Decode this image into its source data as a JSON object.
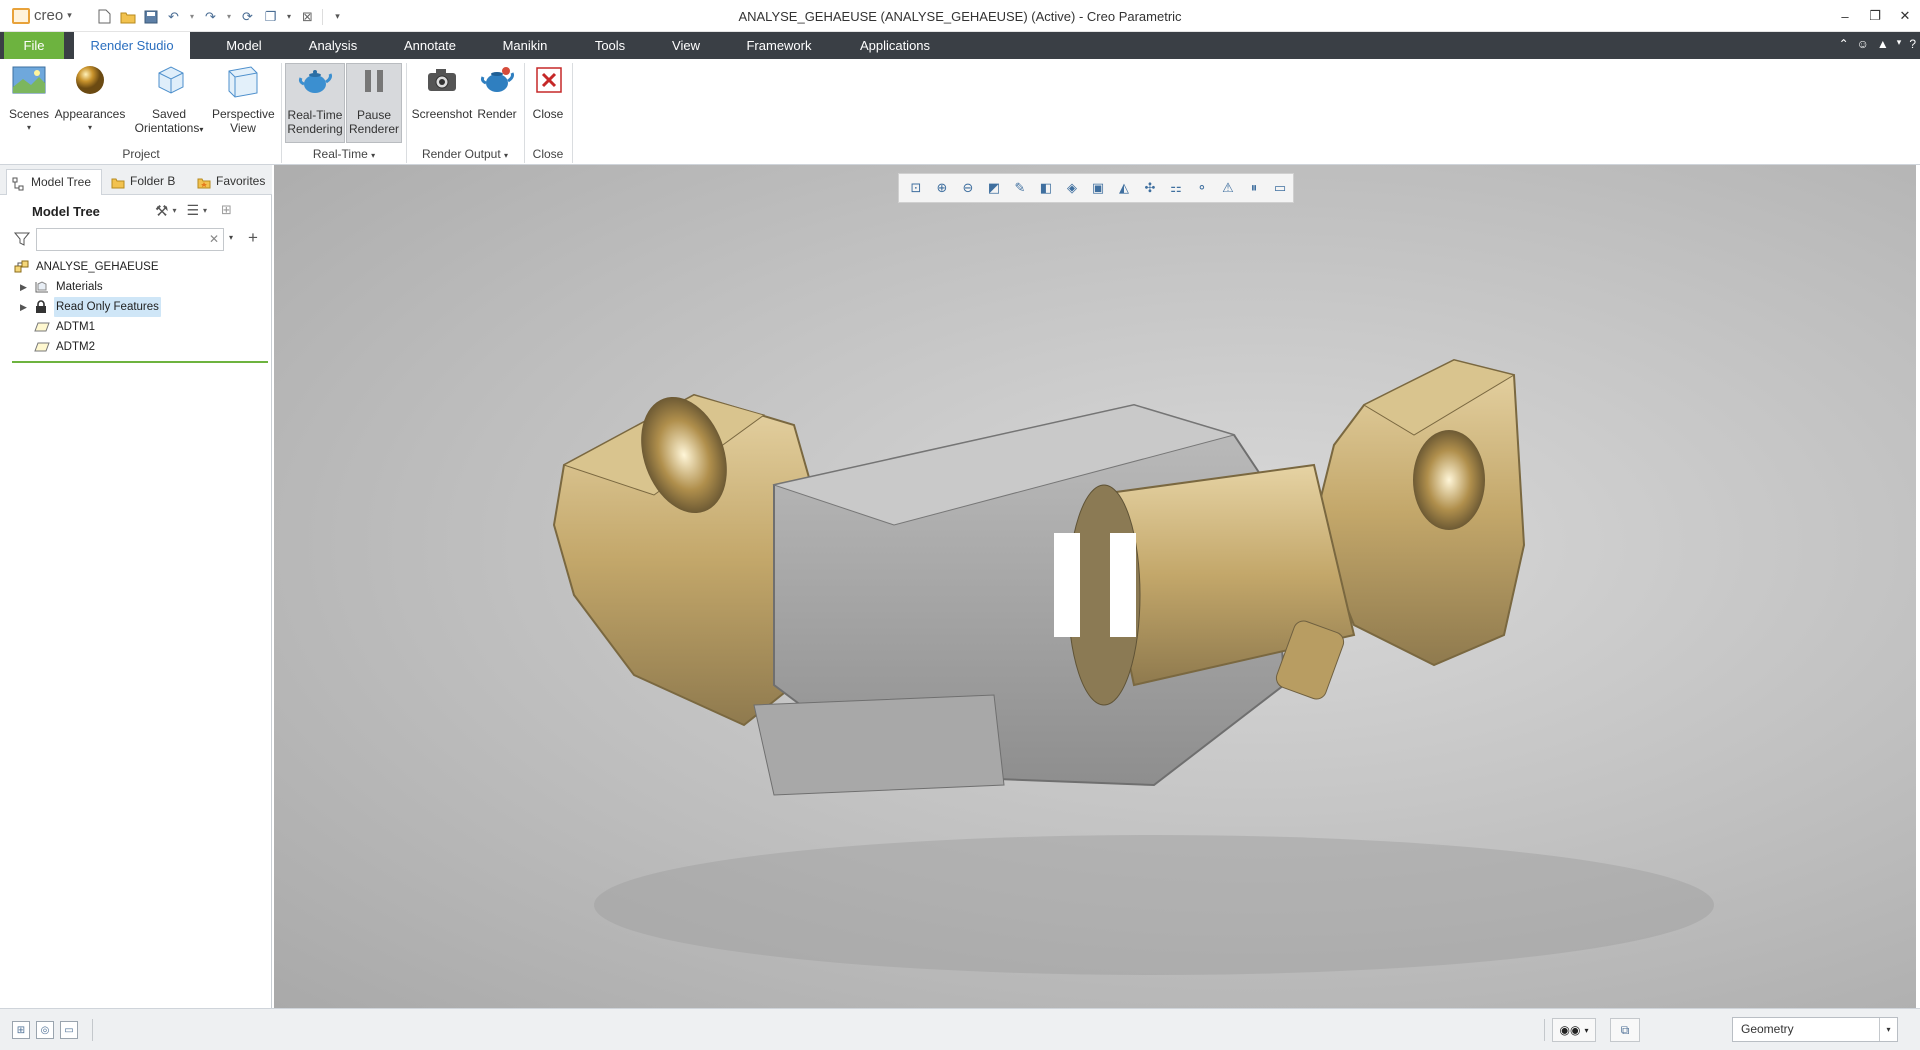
{
  "app": {
    "logo": "creo",
    "window_title": "ANALYSE_GEHAEUSE (ANALYSE_GEHAEUSE) (Active) - Creo Parametric"
  },
  "quick_access": [
    "new-icon",
    "open-icon",
    "save-icon",
    "undo-icon",
    "redo-icon",
    "regenerate-icon",
    "windows-icon",
    "close-window-icon",
    "customize-icon"
  ],
  "ribbon_tabs": [
    {
      "label": "File"
    },
    {
      "label": "Render Studio"
    },
    {
      "label": "Model"
    },
    {
      "label": "Analysis"
    },
    {
      "label": "Annotate"
    },
    {
      "label": "Manikin"
    },
    {
      "label": "Tools"
    },
    {
      "label": "View"
    },
    {
      "label": "Framework"
    },
    {
      "label": "Applications"
    }
  ],
  "ribbon": {
    "scenes": {
      "label": "Scenes"
    },
    "appearances": {
      "label": "Appearances"
    },
    "saved_orientations": {
      "label1": "Saved",
      "label2": "Orientations"
    },
    "perspective_view": {
      "label1": "Perspective",
      "label2": "View"
    },
    "realtime_rendering": {
      "label1": "Real-Time",
      "label2": "Rendering"
    },
    "pause_renderer": {
      "label1": "Pause",
      "label2": "Renderer"
    },
    "screenshot": {
      "label": "Screenshot"
    },
    "render": {
      "label": "Render"
    },
    "close": {
      "label": "Close"
    },
    "groups": {
      "project": "Project",
      "realtime": "Real-Time",
      "render_output": "Render Output",
      "close": "Close"
    }
  },
  "left_panel": {
    "tabs": [
      {
        "label": "Model Tree"
      },
      {
        "label": "Folder B"
      },
      {
        "label": "Favorites"
      }
    ],
    "title": "Model Tree",
    "search_placeholder": "",
    "tree": [
      {
        "label": "ANALYSE_GEHAEUSE",
        "icon": "assembly-icon"
      },
      {
        "label": "Materials",
        "icon": "materials-icon"
      },
      {
        "label": "Read Only Features",
        "icon": "lock-icon"
      },
      {
        "label": "ADTM1",
        "icon": "datum-plane-icon"
      },
      {
        "label": "ADTM2",
        "icon": "datum-plane-icon"
      }
    ]
  },
  "statusbar": {
    "filter_value": "Geometry"
  },
  "colors": {
    "file_tab": "#6db33f",
    "tab_bar": "#3a3f45",
    "active_tab_text": "#2b6fbf",
    "selection": "#cfe6f7"
  }
}
